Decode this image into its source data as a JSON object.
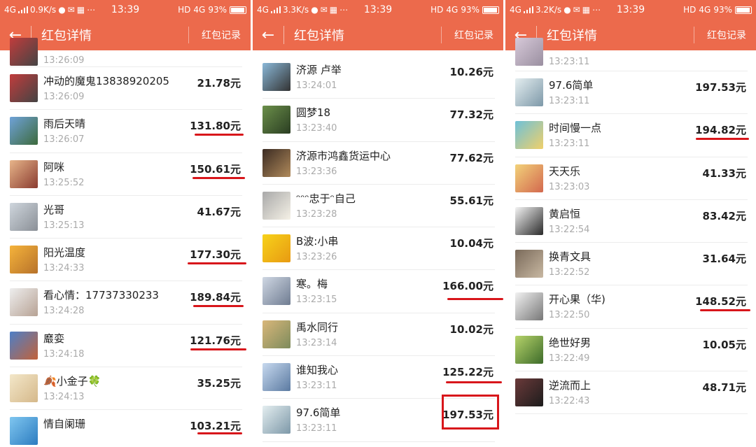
{
  "common": {
    "app_title": "红包详情",
    "record_label": "红包记录",
    "back_icon": "arrow-left-icon",
    "accent_color": "#ec6a4c",
    "mark_color": "#d8161b"
  },
  "screens": [
    {
      "status": {
        "network": "4G",
        "speed": "0.9K/s",
        "time": "13:39",
        "hd": "HD",
        "net4g": "4G",
        "battery": "93%"
      },
      "top_partial_time": "13:26:09",
      "items": [
        {
          "name": "冲动的魔鬼13838920205",
          "time": "13:26:09",
          "amount": "21.78元"
        },
        {
          "name": "雨后天晴",
          "time": "13:26:07",
          "amount": "131.80元"
        },
        {
          "name": "阿咪",
          "time": "13:25:52",
          "amount": "150.61元"
        },
        {
          "name": "光哥",
          "time": "13:25:13",
          "amount": "41.67元"
        },
        {
          "name": "阳光温度",
          "time": "13:24:33",
          "amount": "177.30元"
        },
        {
          "name": "看心情：17737330233",
          "time": "13:24:28",
          "amount": "189.84元"
        },
        {
          "name": "黀娈",
          "time": "13:24:18",
          "amount": "121.76元"
        },
        {
          "name": "🍂小金子🍀",
          "time": "13:24:13",
          "amount": "35.25元"
        },
        {
          "name": "情自阑珊",
          "time": "",
          "amount": "103.21元"
        }
      ]
    },
    {
      "status": {
        "network": "4G",
        "speed": "3.3K/s",
        "time": "13:39",
        "hd": "HD",
        "net4g": "4G",
        "battery": "93%"
      },
      "items": [
        {
          "name": "济源 卢举",
          "time": "13:24:01",
          "amount": "10.26元"
        },
        {
          "name": "圆梦18",
          "time": "13:23:40",
          "amount": "77.32元"
        },
        {
          "name": "济源市鸿鑫货运中心",
          "time": "13:23:36",
          "amount": "77.62元"
        },
        {
          "name": "ᵔᵔᵔ忠于ᵔ自己",
          "time": "13:23:28",
          "amount": "55.61元"
        },
        {
          "name": "B波:小串",
          "time": "13:23:26",
          "amount": "10.04元"
        },
        {
          "name": "寒。梅",
          "time": "13:23:15",
          "amount": "166.00元"
        },
        {
          "name": "禹水同行",
          "time": "13:23:14",
          "amount": "10.02元"
        },
        {
          "name": "谁知我心",
          "time": "13:23:11",
          "amount": "125.22元"
        },
        {
          "name": "97.6简单",
          "time": "13:23:11",
          "amount": "197.53元"
        }
      ]
    },
    {
      "status": {
        "network": "4G",
        "speed": "3.2K/s",
        "time": "13:39",
        "hd": "HD",
        "net4g": "4G",
        "battery": "93%"
      },
      "top_partial_time": "13:23:11",
      "items": [
        {
          "name": "97.6简单",
          "time": "13:23:11",
          "amount": "197.53元"
        },
        {
          "name": "时间慢一点",
          "time": "13:23:11",
          "amount": "194.82元"
        },
        {
          "name": "天天乐",
          "time": "13:23:03",
          "amount": "41.33元"
        },
        {
          "name": "黄启恒",
          "time": "13:22:54",
          "amount": "83.42元"
        },
        {
          "name": "换青文具",
          "time": "13:22:52",
          "amount": "31.64元"
        },
        {
          "name": "开心果（华)",
          "time": "13:22:50",
          "amount": "148.52元"
        },
        {
          "name": "绝世好男",
          "time": "13:22:49",
          "amount": "10.05元"
        },
        {
          "name": "逆流而上",
          "time": "13:22:43",
          "amount": "48.71元"
        }
      ]
    }
  ]
}
